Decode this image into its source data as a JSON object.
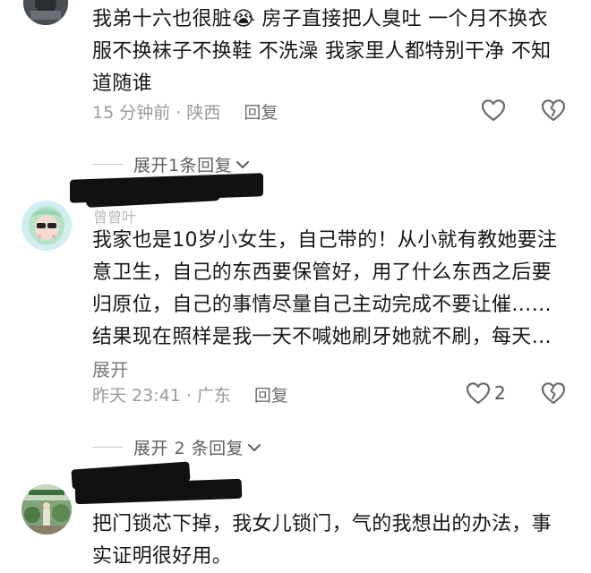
{
  "comments": [
    {
      "text": "我弟十六也很脏😭 房子直接把人臭吐 一个月不换衣服不换袜子不换鞋 不洗澡 我家里人都特别干净 不知道随谁",
      "time": "15 分钟前 · 陕西",
      "reply_label": "回复",
      "like_count": "",
      "expand_replies": "展开1条回复"
    },
    {
      "username_partial": "曾曾叶",
      "text": "我家也是10岁小女生，自己带的！从小就有教她要注意卫生，自己的东西要保管好，用了什么东西之后要归原位，自己的事情尽量自己主动完成不要让催……结果现在照样是我一天不喊她刷牙她就不刷，每天…",
      "inline_expand": "展开",
      "time": "昨天 23:41 · 广东",
      "reply_label": "回复",
      "like_count": "2",
      "expand_replies": "展开 2 条回复"
    },
    {
      "text": "把门锁芯下掉，我女儿锁门，气的我想出的办法，事实证明很好用。"
    }
  ],
  "icons": {
    "like": "heart-outline-icon",
    "dislike": "broken-heart-icon",
    "expand": "chevron-down-icon"
  },
  "colors": {
    "text": "#161616",
    "meta": "#9a9a9a",
    "reply": "#6d6d6d",
    "redaction": "#111111"
  }
}
